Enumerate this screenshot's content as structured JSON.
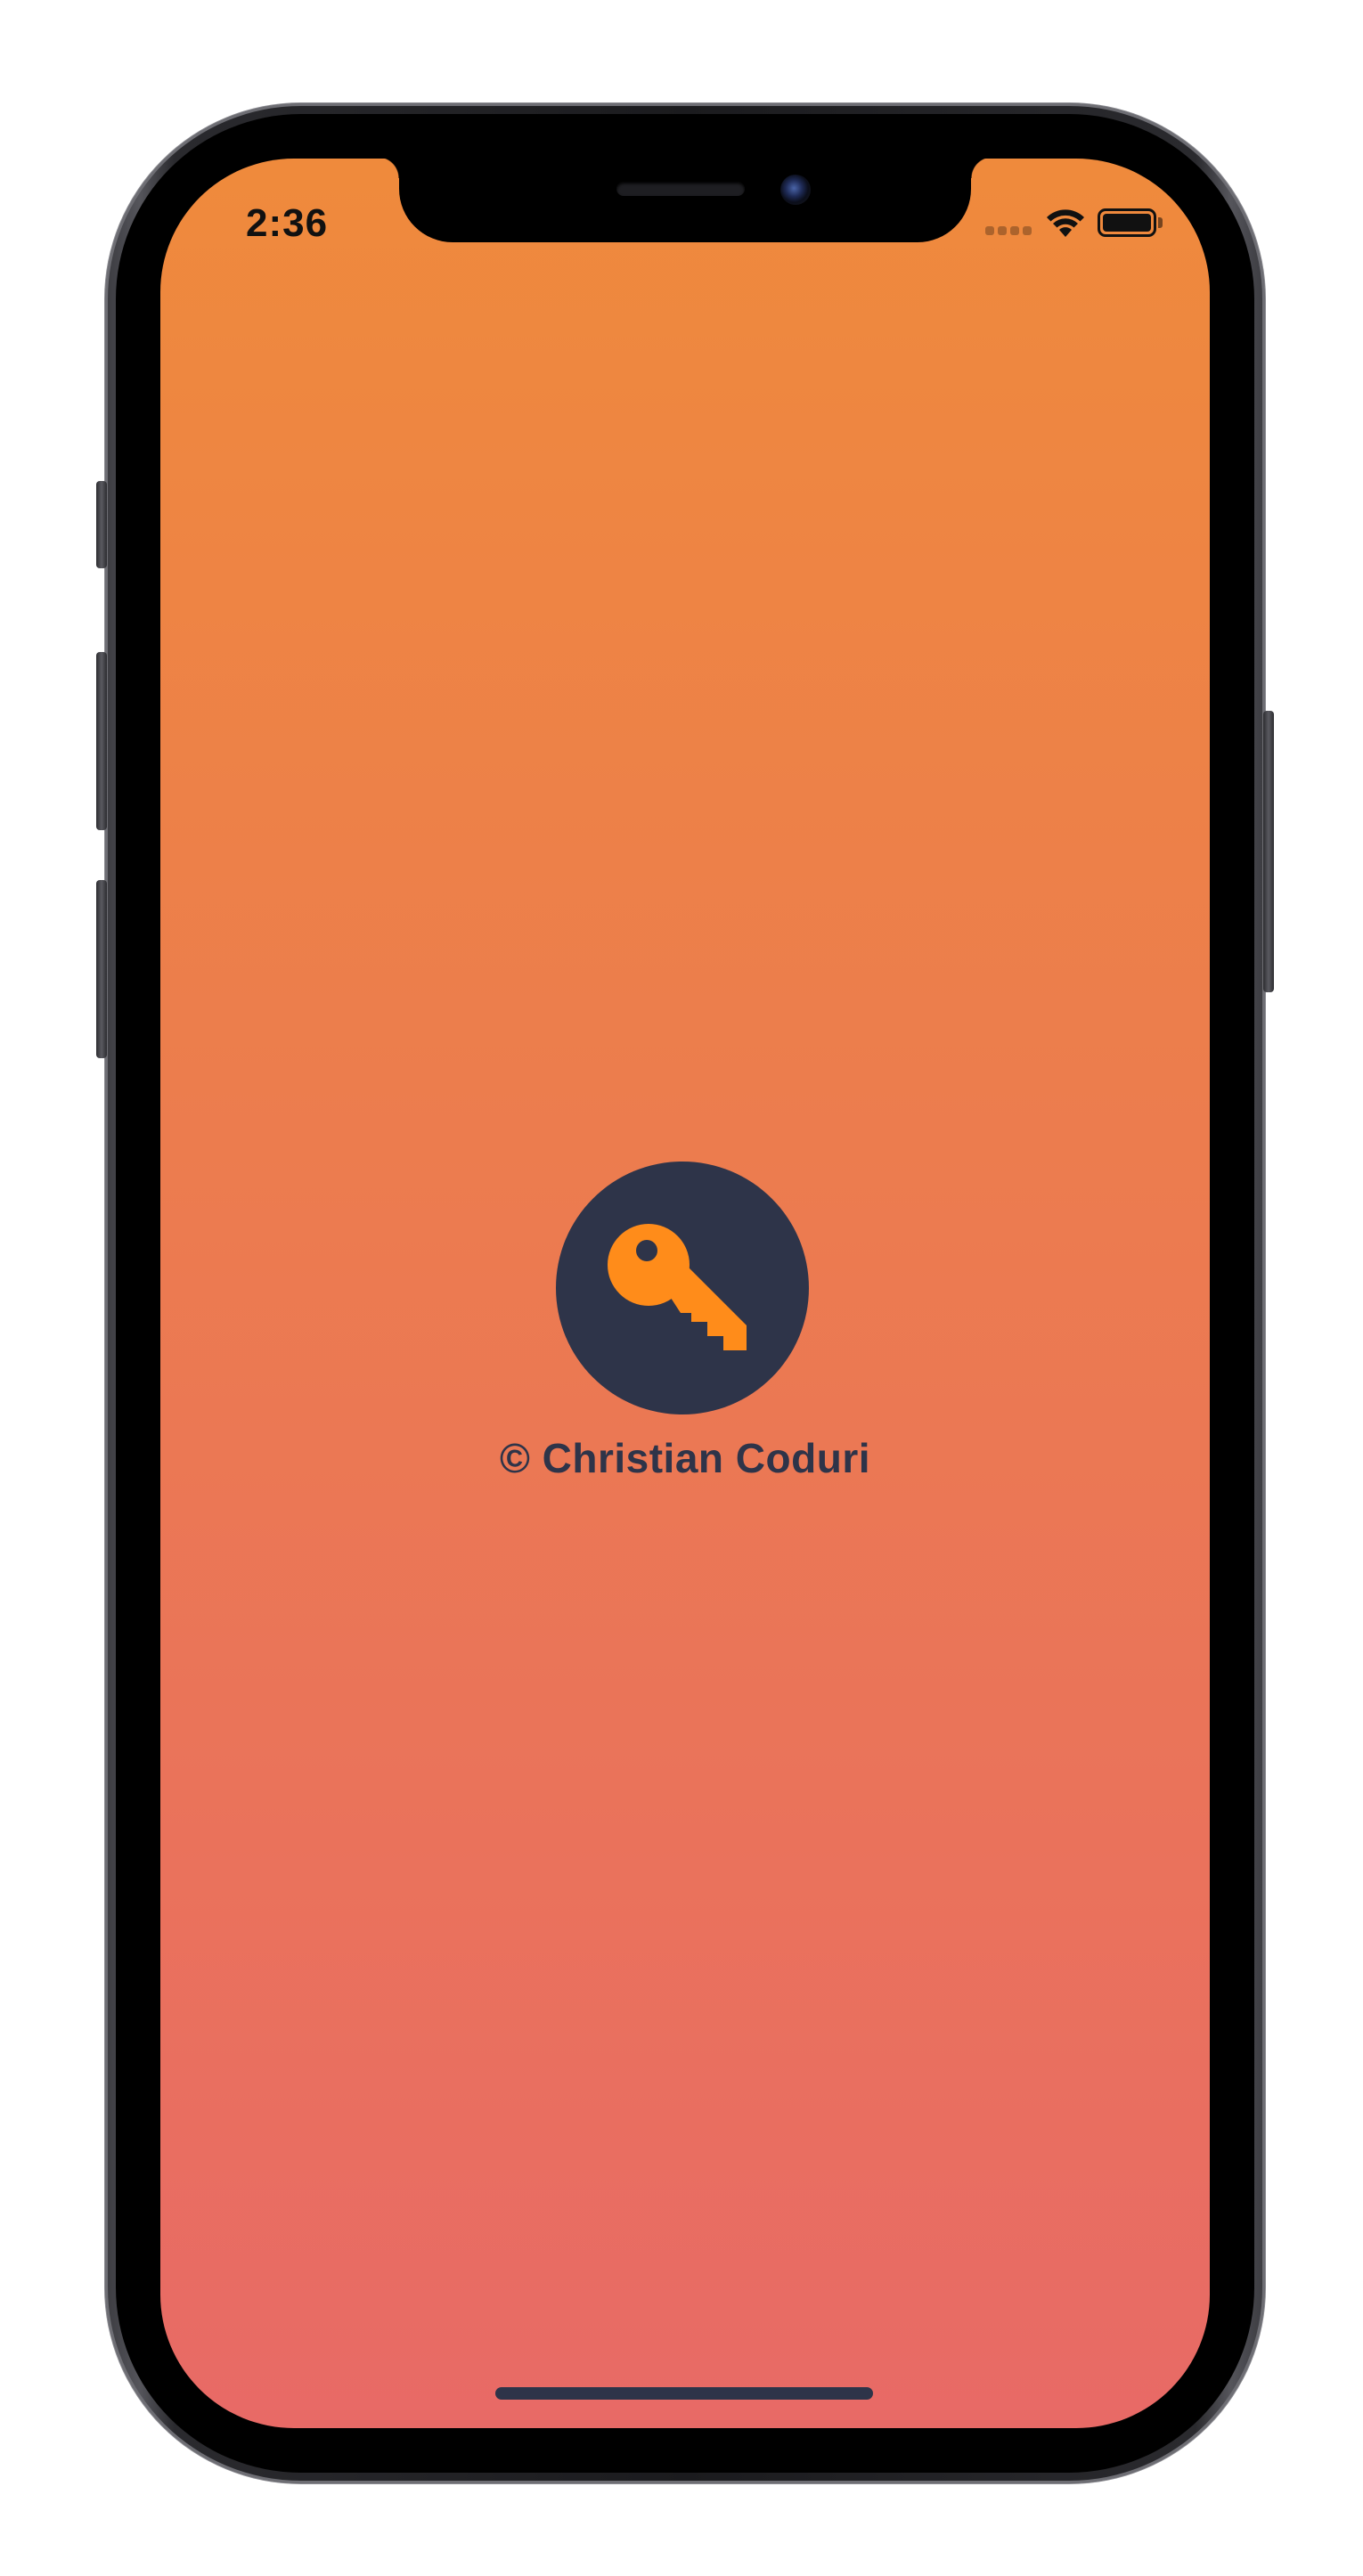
{
  "status_bar": {
    "time": "2:36"
  },
  "splash": {
    "copyright": "© Christian Coduri",
    "logo_icon": "key-icon"
  },
  "colors": {
    "gradient_top": "#ef8a3c",
    "gradient_bottom": "#e86a66",
    "logo_circle": "#2e3449",
    "key": "#ff8c1a",
    "text": "#2e3449"
  }
}
